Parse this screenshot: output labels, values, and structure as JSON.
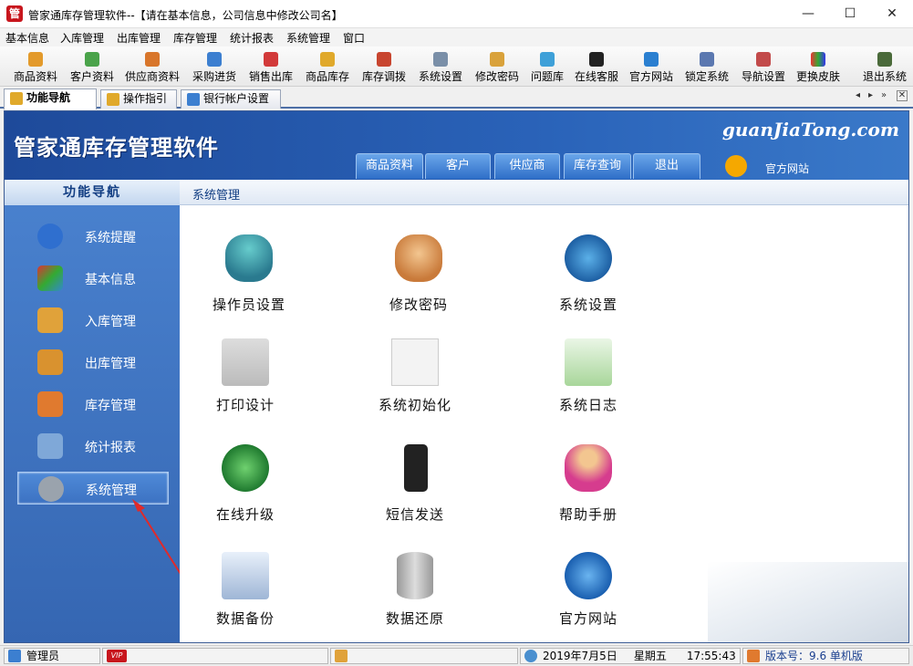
{
  "window": {
    "title": "管家通库存管理软件--【请在基本信息，公司信息中修改公司名】",
    "app_icon_char": "管",
    "min": "—",
    "max": "☐",
    "close": "✕"
  },
  "menu": [
    "基本信息",
    "入库管理",
    "出库管理",
    "库存管理",
    "统计报表",
    "系统管理",
    "窗口"
  ],
  "toolbar": [
    "商品资料",
    "客户资料",
    "供应商资料",
    "采购进货",
    "销售出库",
    "商品库存",
    "库存调拨",
    "系统设置",
    "修改密码",
    "问题库",
    "在线客服",
    "官方网站",
    "锁定系统",
    "导航设置",
    "更换皮肤",
    "退出系统"
  ],
  "tabs": [
    "功能导航",
    "操作指引",
    "银行帐户设置"
  ],
  "tab_nav": [
    "◂",
    "▸",
    "»",
    "✕"
  ],
  "banner": {
    "title": "管家通库存管理软件",
    "site": "guanJiaTong.com",
    "nav": [
      "商品资料",
      "客户",
      "供应商",
      "库存查询",
      "退出"
    ],
    "official": "官方网站"
  },
  "sidebar": {
    "header": "功能导航",
    "items": [
      "系统提醒",
      "基本信息",
      "入库管理",
      "出库管理",
      "库存管理",
      "统计报表",
      "系统管理"
    ],
    "selected": "系统管理"
  },
  "content": {
    "header": "系统管理",
    "functions": [
      "操作员设置",
      "修改密码",
      "系统设置",
      "打印设计",
      "系统初始化",
      "系统日志",
      "在线升级",
      "短信发送",
      "帮助手册",
      "数据备份",
      "数据还原",
      "官方网站"
    ]
  },
  "status": {
    "user": "管理员",
    "vip": "VIP",
    "date": "2019年7月5日",
    "weekday": "星期五",
    "time": "17:55:43",
    "version": "版本号：9.6 单机版"
  },
  "colors": {
    "accent": "#2a63b9",
    "sidebar": "#4a82cf",
    "selected_item_border": "#a8c9f2"
  }
}
